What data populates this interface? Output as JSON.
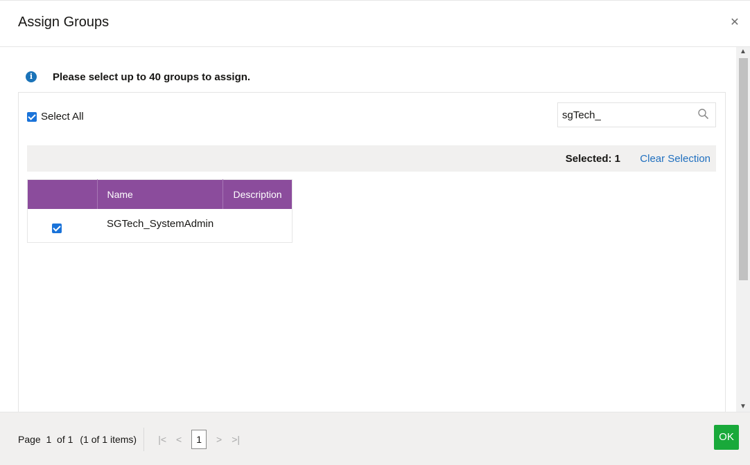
{
  "dialog": {
    "title": "Assign Groups",
    "close_icon": "close-icon"
  },
  "info": {
    "icon": "info-icon",
    "text": "Please select up to 40 groups to assign."
  },
  "select_all": {
    "label": "Select All",
    "checked": true
  },
  "search": {
    "value": "sgTech_",
    "icon": "search-icon"
  },
  "selection_bar": {
    "count_text": "Selected: 1",
    "clear_label": "Clear Selection"
  },
  "table": {
    "headers": [
      "",
      "Name",
      "Description"
    ],
    "rows": [
      {
        "checked": true,
        "name": "SGTech_SystemAdmin",
        "description": ""
      }
    ]
  },
  "pager": {
    "page_text": "Page  1  of 1",
    "items_text": "(1 of 1 items)",
    "current_page": "1",
    "first_icon": "first-page-icon",
    "prev_icon": "prev-page-icon",
    "next_icon": "next-page-icon",
    "last_icon": "last-page-icon"
  },
  "buttons": {
    "ok_label": "OK"
  },
  "colors": {
    "header_bg": "#8b4c9c",
    "accent_blue": "#1a73d9",
    "link": "#1f6fbf",
    "ok_green": "#19a93a"
  }
}
